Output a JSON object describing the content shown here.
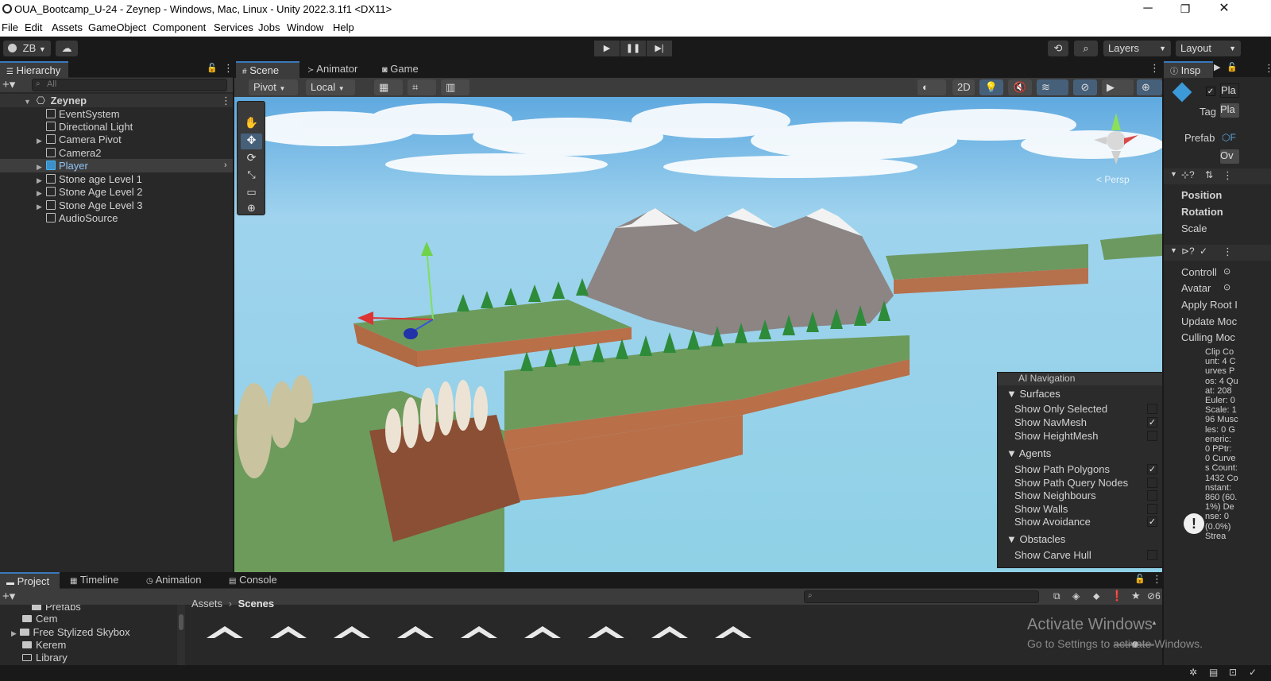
{
  "window": {
    "title": "OUA_Bootcamp_U-24 - Zeynep - Windows, Mac, Linux - Unity 2022.3.1f1 <DX11>",
    "min": "─",
    "max": "❐",
    "close": "✕"
  },
  "menu": [
    "File",
    "Edit",
    "Assets",
    "GameObject",
    "Component",
    "Services",
    "Jobs",
    "Window",
    "Help"
  ],
  "toolbar": {
    "account": "ZB",
    "layers": "Layers",
    "layout": "Layout"
  },
  "hierarchy": {
    "tab": "Hierarchy",
    "search_placeholder": "All",
    "scene": "Zeynep",
    "items": [
      {
        "label": "EventSystem",
        "expandable": false
      },
      {
        "label": "Directional Light",
        "expandable": false
      },
      {
        "label": "Camera Pivot",
        "expandable": true
      },
      {
        "label": "Camera2",
        "expandable": false
      },
      {
        "label": "Player",
        "expandable": true,
        "selected": true
      },
      {
        "label": "Stone age Level 1",
        "expandable": true
      },
      {
        "label": "Stone Age Level 2",
        "expandable": true
      },
      {
        "label": "Stone Age Level 3",
        "expandable": true
      },
      {
        "label": "AudioSource",
        "expandable": false
      }
    ]
  },
  "scene_tabs": [
    "Scene",
    "Animator",
    "Game"
  ],
  "scene_toolbar": {
    "pivot": "Pivot",
    "local": "Local",
    "mode_2d": "2D",
    "persp": "< Persp"
  },
  "ai_navigation": {
    "title": "AI Navigation",
    "sections": [
      {
        "name": "Surfaces",
        "items": [
          {
            "label": "Show Only Selected",
            "checked": false
          },
          {
            "label": "Show NavMesh",
            "checked": true
          },
          {
            "label": "Show HeightMesh",
            "checked": false
          }
        ]
      },
      {
        "name": "Agents",
        "items": [
          {
            "label": "Show Path Polygons",
            "checked": true
          },
          {
            "label": "Show Path Query Nodes",
            "checked": false
          },
          {
            "label": "Show Neighbours",
            "checked": false
          },
          {
            "label": "Show Walls",
            "checked": false
          },
          {
            "label": "Show Avoidance",
            "checked": true
          }
        ]
      },
      {
        "name": "Obstacles",
        "items": [
          {
            "label": "Show Carve Hull",
            "checked": false
          }
        ]
      }
    ]
  },
  "inspector": {
    "tab": "Insp",
    "name_field": "Pla",
    "tag_label": "Tag",
    "tag_value": "Pla",
    "prefab_label": "Prefab",
    "overrides": "Ov",
    "transform_rows": [
      "Position",
      "Rotation",
      "Scale"
    ],
    "animator_rows": [
      "Controll",
      "Avatar",
      "Apply Root I",
      "Update Moc",
      "Culling Moc"
    ],
    "stats": "Clip Count: 4 Curves Pos: 4 Quat: 208 Euler: 0 Scale: 196 Muscles: 0 Generic: 0 PPtr: 0 Curves Count: 1432 Constant: 860 (60.1%) Dense: 0 (0.0%) Strea"
  },
  "project": {
    "tabs": [
      "Project",
      "Timeline",
      "Animation",
      "Console"
    ],
    "tree": [
      "Prefabs",
      "Cem",
      "Free Stylized Skybox",
      "Kerem",
      "Library"
    ],
    "breadcrumb": [
      "Assets",
      "Scenes"
    ],
    "hidden_count": "6"
  },
  "watermark": {
    "line1": "Activate Windows",
    "line2": "Go to Settings to activate Windows."
  },
  "colors": {
    "accent": "#3a79bb",
    "panel": "#282828",
    "selected_row": "#3e3e3e",
    "sky": "#8fd1e6"
  }
}
